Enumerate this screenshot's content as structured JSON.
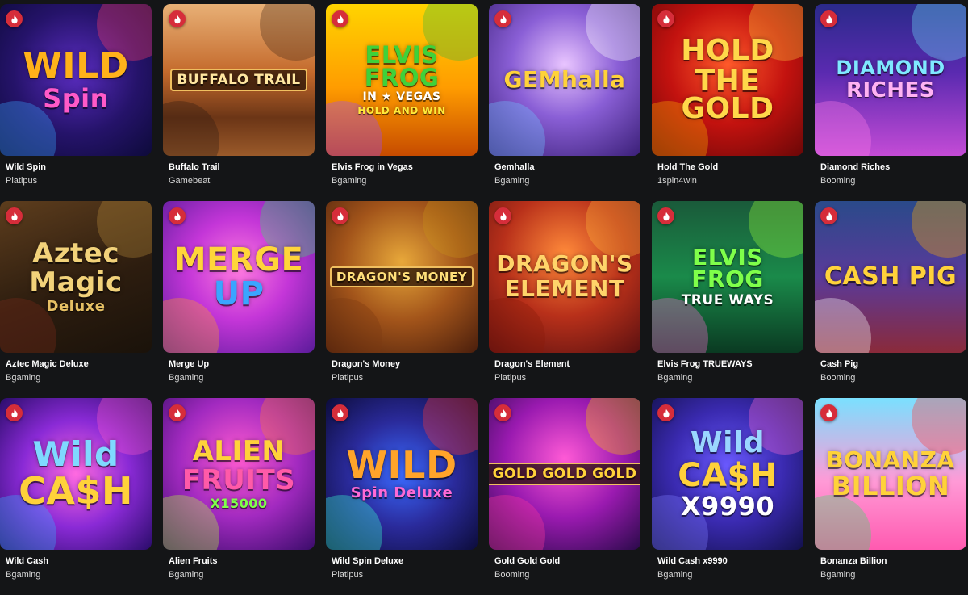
{
  "hot_badge_icon": "flame-icon",
  "colors": {
    "background": "#141517",
    "hot_badge": "#d62d3a"
  },
  "games": [
    {
      "title": "Wild Spin",
      "provider": "Platipus",
      "art": [
        "WILD",
        "Spin"
      ]
    },
    {
      "title": "Buffalo Trail",
      "provider": "Gamebeat",
      "art": [
        "BUFFALO TRAIL"
      ]
    },
    {
      "title": "Elvis Frog in Vegas",
      "provider": "Bgaming",
      "art": [
        "ELVIS FROG",
        "IN ★ VEGAS",
        "HOLD AND WIN"
      ]
    },
    {
      "title": "Gemhalla",
      "provider": "Bgaming",
      "art": [
        "GEMhalla"
      ]
    },
    {
      "title": "Hold The Gold",
      "provider": "1spin4win",
      "art": [
        "HOLD",
        "THE GOLD"
      ]
    },
    {
      "title": "Diamond Riches",
      "provider": "Booming",
      "art": [
        "DIAMOND",
        "RICHES"
      ]
    },
    {
      "title": "Aztec Magic Deluxe",
      "provider": "Bgaming",
      "art": [
        "Aztec",
        "Magic",
        "Deluxe"
      ]
    },
    {
      "title": "Merge Up",
      "provider": "Bgaming",
      "art": [
        "MERGE",
        "UP"
      ]
    },
    {
      "title": "Dragon's Money",
      "provider": "Platipus",
      "art": [
        "DRAGON'S MONEY"
      ]
    },
    {
      "title": "Dragon's Element",
      "provider": "Platipus",
      "art": [
        "DRAGON'S",
        "ELEMENT"
      ]
    },
    {
      "title": "Elvis Frog TRUEWAYS",
      "provider": "Bgaming",
      "art": [
        "ELVIS FROG",
        "TRUE WAYS"
      ]
    },
    {
      "title": "Cash Pig",
      "provider": "Booming",
      "art": [
        "CASH PIG"
      ]
    },
    {
      "title": "Wild Cash",
      "provider": "Bgaming",
      "art": [
        "Wild",
        "CA$H"
      ]
    },
    {
      "title": "Alien Fruits",
      "provider": "Bgaming",
      "art": [
        "ALIEN",
        "FRUITS",
        "X15000"
      ]
    },
    {
      "title": "Wild Spin Deluxe",
      "provider": "Platipus",
      "art": [
        "WILD",
        "Spin Deluxe"
      ]
    },
    {
      "title": "Gold Gold Gold",
      "provider": "Booming",
      "art": [
        "GOLD GOLD GOLD"
      ]
    },
    {
      "title": "Wild Cash x9990",
      "provider": "Bgaming",
      "art": [
        "Wild",
        "CA$H",
        "X9990"
      ]
    },
    {
      "title": "Bonanza Billion",
      "provider": "Bgaming",
      "art": [
        "BONANZA",
        "BILLION"
      ]
    }
  ]
}
